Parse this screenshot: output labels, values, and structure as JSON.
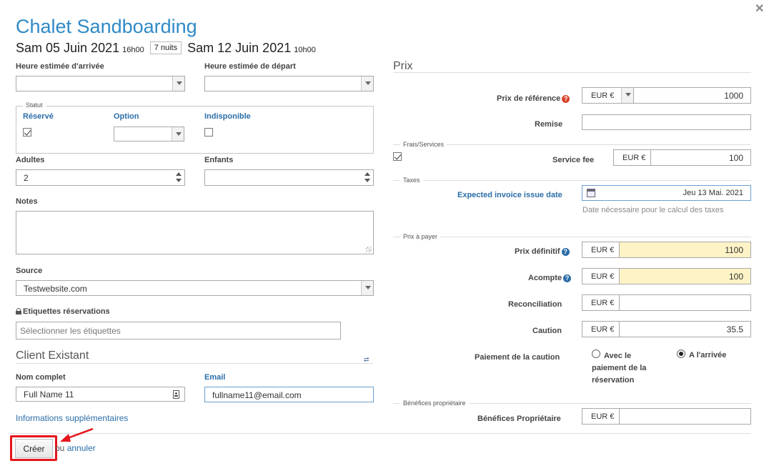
{
  "booking": {
    "title": "Chalet Sandboarding",
    "arrival_date": "Sam 05 Juin 2021",
    "arrival_time": "16h00",
    "nights": "7 nuits",
    "departure_date": "Sam 12 Juin 2021",
    "departure_time": "10h00"
  },
  "left": {
    "eta_label": "Heure estimée d'arrivée",
    "etd_label": "Heure estimée de départ",
    "statut_legend": "Statut",
    "reserve_label": "Réservé",
    "option_label": "Option",
    "indisponible_label": "Indisponible",
    "adultes_label": "Adultes",
    "adultes_value": "2",
    "enfants_label": "Enfants",
    "notes_label": "Notes",
    "source_label": "Source",
    "source_value": "Testwebsite.com",
    "etiquettes_label": "Etiquettes réservations",
    "etiquettes_placeholder": "Sélectionner les étiquettes"
  },
  "client": {
    "section_title": "Client Existant",
    "name_label": "Nom complet",
    "name_value": "Full Name 11",
    "email_label": "Email",
    "email_value": "fullname11@email.com",
    "more_info_link": "Informations supplémentaires"
  },
  "prix": {
    "section_title": "Prix",
    "currency": "EUR €",
    "ref_label": "Prix de référence",
    "ref_value": "1000",
    "remise_label": "Remise",
    "frais_legend": "Frais/Services",
    "service_fee_label": "Service fee",
    "service_fee_value": "100",
    "taxes_legend": "Taxes",
    "invoice_date_label": "Expected invoice issue date",
    "invoice_date_value": "Jeu 13 Mai. 2021",
    "invoice_date_hint": "Date nécessaire pour le calcul des taxes",
    "payer_legend": "Prix à payer",
    "definitif_label": "Prix définitif",
    "definitif_value": "1100",
    "acompte_label": "Acompte",
    "acompte_value": "100",
    "reconciliation_label": "Reconciliation",
    "caution_label": "Caution",
    "caution_value": "35.5",
    "paiement_caution_label": "Paiement de la caution",
    "radio_avec_label": "Avec le paiement de la réservation",
    "radio_arrivee_label": "A l'arrivée",
    "benefices_legend": "Bénéfices propriétaire",
    "benefices_label": "Bénéfices Propriétaire"
  },
  "footer": {
    "create_button": "Créer",
    "or_text": "ou",
    "cancel_link": "annuler"
  },
  "icons": {
    "close": "close-icon",
    "help": "help-icon",
    "calendar": "calendar-icon",
    "contact": "contact-card-icon",
    "lock": "lock-icon"
  },
  "colors": {
    "title_blue": "#2f8ac6",
    "link_blue": "#2b6ea8",
    "highlight_yellow": "#fdf3c6",
    "annotation_red": "#e5151b"
  }
}
